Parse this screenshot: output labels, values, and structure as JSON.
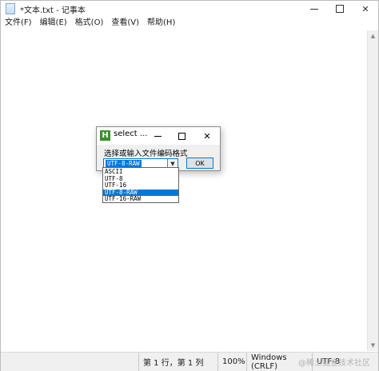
{
  "window": {
    "title": "*文本.txt - 记事本"
  },
  "menu": {
    "items": [
      "文件(F)",
      "编辑(E)",
      "格式(O)",
      "查看(V)",
      "帮助(H)"
    ]
  },
  "dialog": {
    "title": "select ...",
    "icon_letter": "H",
    "label": "选择或输入文件编码格式",
    "combo_value": "UTF-8-RAW",
    "ok_label": "OK",
    "options": [
      "ASCII",
      "UTF-8",
      "UTF-16",
      "UTF-8-RAW",
      "UTF-16-RAW"
    ],
    "selected_option": "UTF-8-RAW"
  },
  "status": {
    "position": "第 1 行，第 1 列",
    "zoom": "100%",
    "line_ending": "Windows (CRLF)",
    "encoding": "UTF-8"
  },
  "watermark": "@稀土掘金技术社区",
  "colors": {
    "accent": "#0078d7",
    "dialog_icon": "#3a8f2b"
  }
}
